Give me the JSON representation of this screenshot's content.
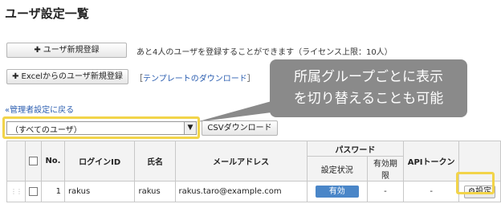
{
  "page": {
    "title": "ユーザ設定一覧"
  },
  "toolbar": {
    "add_user_label": "ユーザ新規登録",
    "add_user_note": "あと4人のユーザを登録することができます（ライセンス上限：10人）",
    "excel_import_label": "Excelからのユーザ新規登録",
    "template_link_open": "［",
    "template_link": "テンプレートのダウンロード",
    "template_link_close": "］",
    "back_link": "«管理者設定に戻る"
  },
  "callout": {
    "line1": "所属グループごとに表示",
    "line2": "を切り替えることも可能"
  },
  "filter": {
    "selected": "（すべてのユーザ）",
    "csv_label": "CSVダウンロード"
  },
  "table": {
    "headers": {
      "no": "No.",
      "login_id": "ログインID",
      "name": "氏名",
      "email": "メールアドレス",
      "password": "パスワード",
      "pw_status": "設定状況",
      "pw_expiry": "有効期限",
      "api_token": "APIトークン"
    },
    "rows": [
      {
        "no": "1",
        "login_id": "rakus",
        "name": "rakus",
        "email": "rakus.taro@example.com",
        "pw_status": "有効",
        "pw_expiry": "-",
        "api_token": "-",
        "settings_label": "設定"
      }
    ]
  },
  "colors": {
    "highlight": "#f2d44a",
    "callout_bg": "#8a8a8a",
    "status": "#4a86c8",
    "link": "#2a5db0"
  },
  "icons": {
    "plus": "plus-icon",
    "gear": "gear-icon",
    "chevron": "chevron-down-icon"
  }
}
